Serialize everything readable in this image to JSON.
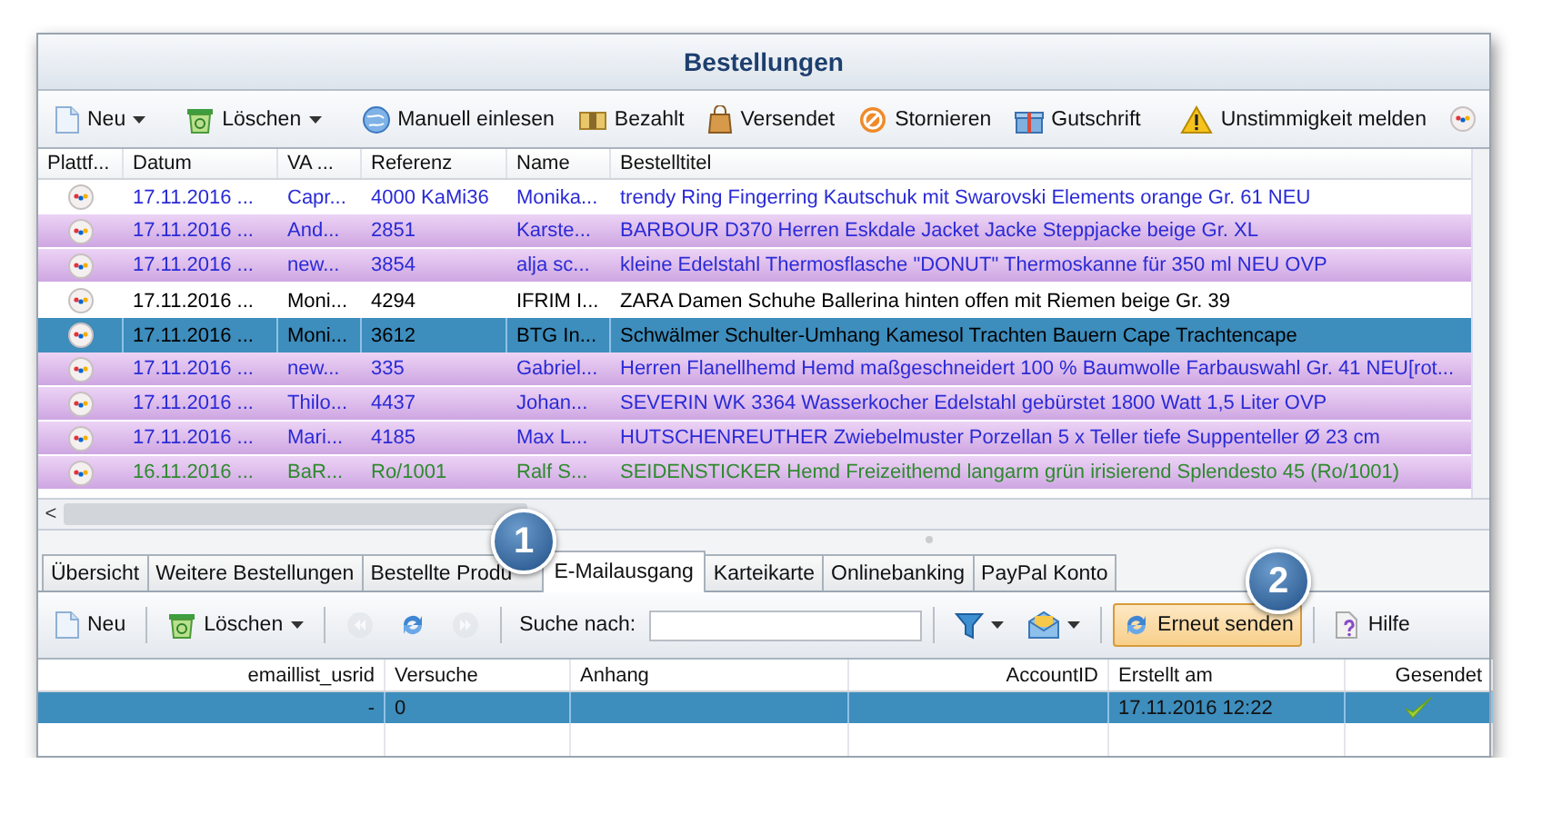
{
  "window": {
    "title": "Bestellungen"
  },
  "toolbar": [
    {
      "label": "Neu",
      "has_menu": true
    },
    {
      "label": "Löschen",
      "has_menu": true
    },
    {
      "label": "Manuell einlesen",
      "has_menu": false
    },
    {
      "label": "Bezahlt",
      "has_menu": false
    },
    {
      "label": "Versendet",
      "has_menu": false
    },
    {
      "label": "Stornieren",
      "has_menu": false
    },
    {
      "label": "Gutschrift",
      "has_menu": false
    },
    {
      "label": "Unstimmigkeit melden",
      "has_menu": false
    }
  ],
  "orders": {
    "columns": [
      "Plattf...",
      "Datum",
      "VA ...",
      "Referenz",
      "Name",
      "Bestelltitel"
    ],
    "rows": [
      {
        "cells": [
          "",
          "17.11.2016 ...",
          "Capr...",
          "4000 KaMi36",
          "Monika...",
          "trendy Ring Fingerring Kautschuk mit Swarovski Elements orange Gr. 61 NEU"
        ],
        "color": "#2a2ad6",
        "highlight": false,
        "selected": false
      },
      {
        "cells": [
          "",
          "17.11.2016 ...",
          "And...",
          "2851",
          "Karste...",
          "BARBOUR D370 Herren Eskdale Jacket Jacke Steppjacke beige Gr. XL"
        ],
        "color": "#2a2ad6",
        "highlight": true,
        "selected": false
      },
      {
        "cells": [
          "",
          "17.11.2016 ...",
          "new...",
          "3854",
          "alja sc...",
          "kleine Edelstahl Thermosflasche \"DONUT\" Thermoskanne für 350 ml NEU OVP"
        ],
        "color": "#2a2ad6",
        "highlight": true,
        "selected": false
      },
      {
        "cells": [
          "",
          "17.11.2016 ...",
          "Moni...",
          "4294",
          "IFRIM I...",
          "ZARA Damen Schuhe Ballerina hinten offen mit Riemen beige Gr. 39"
        ],
        "color": "#000000",
        "highlight": false,
        "selected": false
      },
      {
        "cells": [
          "",
          "17.11.2016 ...",
          "Moni...",
          "3612",
          "BTG In...",
          "Schwälmer Schulter-Umhang Kamesol Trachten Bauern Cape Trachtencape"
        ],
        "color": "#000000",
        "highlight": false,
        "selected": true
      },
      {
        "cells": [
          "",
          "17.11.2016 ...",
          "new...",
          "335",
          "Gabriel...",
          "Herren Flanellhemd Hemd maßgeschneidert 100 % Baumwolle Farbauswahl Gr. 41 NEU[rot..."
        ],
        "color": "#2a2ad6",
        "highlight": true,
        "selected": false
      },
      {
        "cells": [
          "",
          "17.11.2016 ...",
          "Thilo...",
          "4437",
          "Johan...",
          "SEVERIN WK 3364 Wasserkocher Edelstahl gebürstet 1800 Watt 1,5 Liter OVP"
        ],
        "color": "#2a2ad6",
        "highlight": true,
        "selected": false
      },
      {
        "cells": [
          "",
          "17.11.2016 ...",
          "Mari...",
          "4185",
          "Max L...",
          "HUTSCHENREUTHER Zwiebelmuster Porzellan 5 x Teller tiefe Suppenteller Ø 23 cm"
        ],
        "color": "#2a2ad6",
        "highlight": true,
        "selected": false
      },
      {
        "cells": [
          "",
          "16.11.2016 ...",
          "BaR...",
          "Ro/1001",
          "Ralf S...",
          "SEIDENSTICKER Hemd Freizeithemd langarm grün irisierend Splendesto 45 (Ro/1001)"
        ],
        "color": "#2e8a2e",
        "highlight": true,
        "selected": false
      }
    ]
  },
  "scroll_left": "<",
  "tabs": [
    {
      "label": "Übersicht",
      "selected": false
    },
    {
      "label": "Weitere Bestellungen",
      "selected": false
    },
    {
      "label": "Bestellte Produ",
      "selected": false
    },
    {
      "label": "E-Mailausgang",
      "selected": true
    },
    {
      "label": "Karteikarte",
      "selected": false
    },
    {
      "label": "Onlinebanking",
      "selected": false
    },
    {
      "label": "PayPal Konto",
      "selected": false
    }
  ],
  "detail_toolbar": [
    {
      "kind": "button",
      "label": "Neu",
      "has_menu": false
    },
    {
      "kind": "button",
      "label": "Löschen",
      "has_menu": true
    },
    {
      "kind": "icon",
      "disabled": true
    },
    {
      "kind": "icon",
      "disabled": false
    },
    {
      "kind": "icon",
      "disabled": true
    },
    {
      "kind": "search",
      "label": "Suche nach:"
    },
    {
      "kind": "icon",
      "has_menu": true,
      "disabled": false
    },
    {
      "kind": "icon",
      "has_menu": true,
      "disabled": false
    },
    {
      "kind": "button",
      "label": "Erneut senden",
      "pressed": true
    },
    {
      "kind": "button",
      "label": "Hilfe",
      "pressed": false
    }
  ],
  "mail_grid": {
    "columns": [
      "emaillist_usrid",
      "Versuche",
      "Anhang",
      "AccountID",
      "Erstellt am",
      "Gesendet"
    ],
    "rows": [
      {
        "cells": [
          "-",
          "0",
          "",
          "",
          "17.11.2016 12:22"
        ],
        "sent": true,
        "selected": true
      }
    ]
  },
  "callouts": [
    {
      "label": "1"
    },
    {
      "label": "2"
    }
  ]
}
